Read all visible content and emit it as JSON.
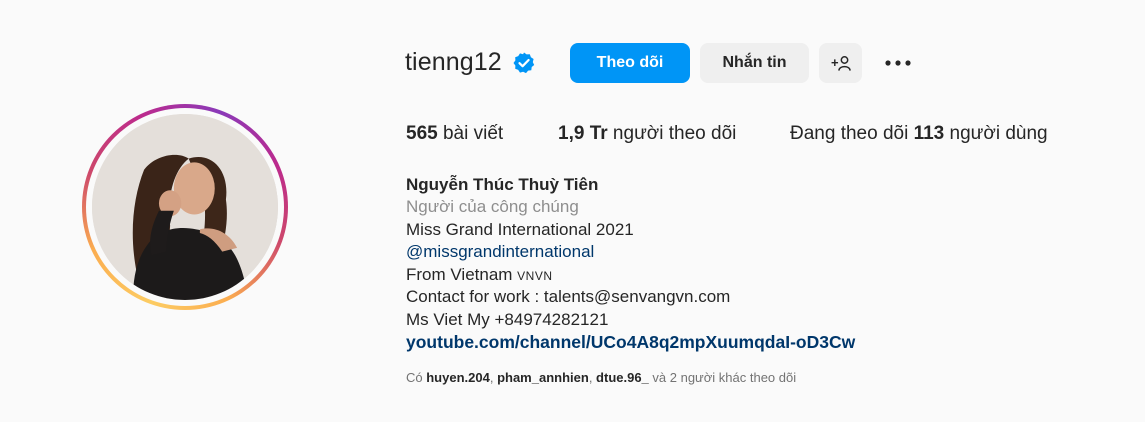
{
  "profile": {
    "username": "tienng12",
    "follow_label": "Theo dõi",
    "message_label": "Nhắn tin",
    "add_user_glyph": "+",
    "more_glyph": "•••",
    "verified_icon": "verified-badge-icon"
  },
  "stats": {
    "posts_count": "565",
    "posts_label": " bài viết",
    "followers_count": "1,9 Tr",
    "followers_label": " người theo dõi",
    "following_prefix": "Đang theo dõi ",
    "following_count": "113",
    "following_suffix": " người dùng"
  },
  "bio": {
    "full_name": "Nguyễn Thúc Thuỳ Tiên",
    "category": "Người của công chúng",
    "line1": "Miss Grand International 2021",
    "mention": "@missgrandinternational",
    "from_text": "From Vietnam ",
    "flags": "VNVN",
    "contact": "Contact for work : talents@senvangvn.com",
    "phone": "Ms Viet My +84974282121",
    "link": "youtube.com/channel/UCo4A8q2mpXuumqdaI-oD3Cw"
  },
  "followed_by": {
    "prefix": "Có ",
    "user1": "huyen.204",
    "sep1": ", ",
    "user2": "pham_annhien",
    "sep2": ", ",
    "user3": "dtue.96_",
    "suffix": " và 2 người khác theo dõi"
  },
  "colors": {
    "primary_button": "#0095f6",
    "secondary_button": "#efefef",
    "link": "#00376b",
    "muted": "#8e8e8e",
    "background": "#fafafa"
  }
}
